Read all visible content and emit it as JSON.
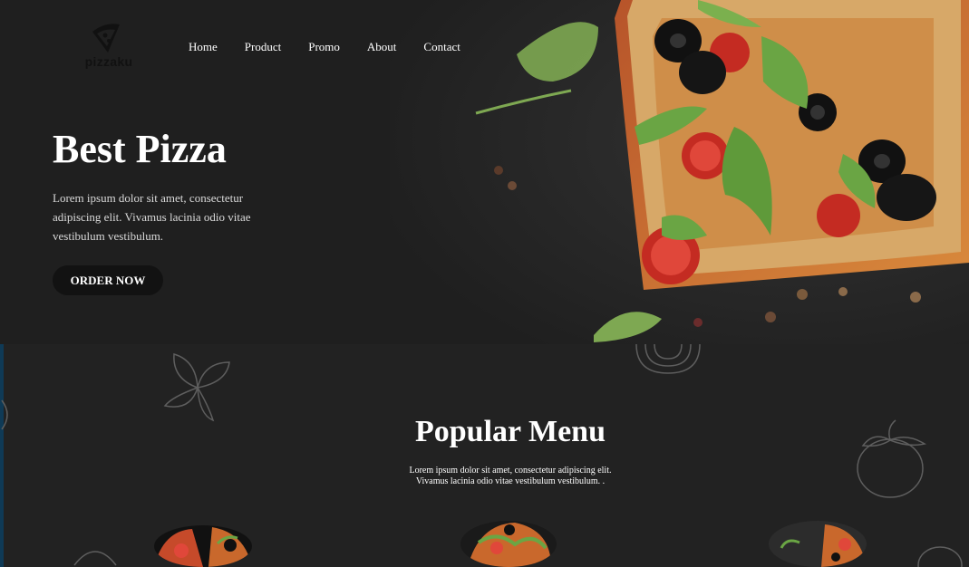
{
  "brand": {
    "name": "pizzaku"
  },
  "nav": {
    "items": [
      "Home",
      "Product",
      "Promo",
      "About",
      "Contact"
    ]
  },
  "hero": {
    "title": "Best Pizza",
    "description": "Lorem ipsum dolor sit amet, consectetur adipiscing elit. Vivamus lacinia odio vitae vestibulum vestibulum.",
    "cta_label": "ORDER NOW"
  },
  "menu": {
    "title": "Popular Menu",
    "description_line1": "Lorem ipsum dolor sit amet, consectetur adipiscing elit.",
    "description_line2": "Vivamus lacinia odio vitae vestibulum vestibulum. ."
  },
  "colors": {
    "background": "#222222",
    "hero_background": "#1f1f1f",
    "button": "#121212",
    "crust": "#c9682c"
  }
}
